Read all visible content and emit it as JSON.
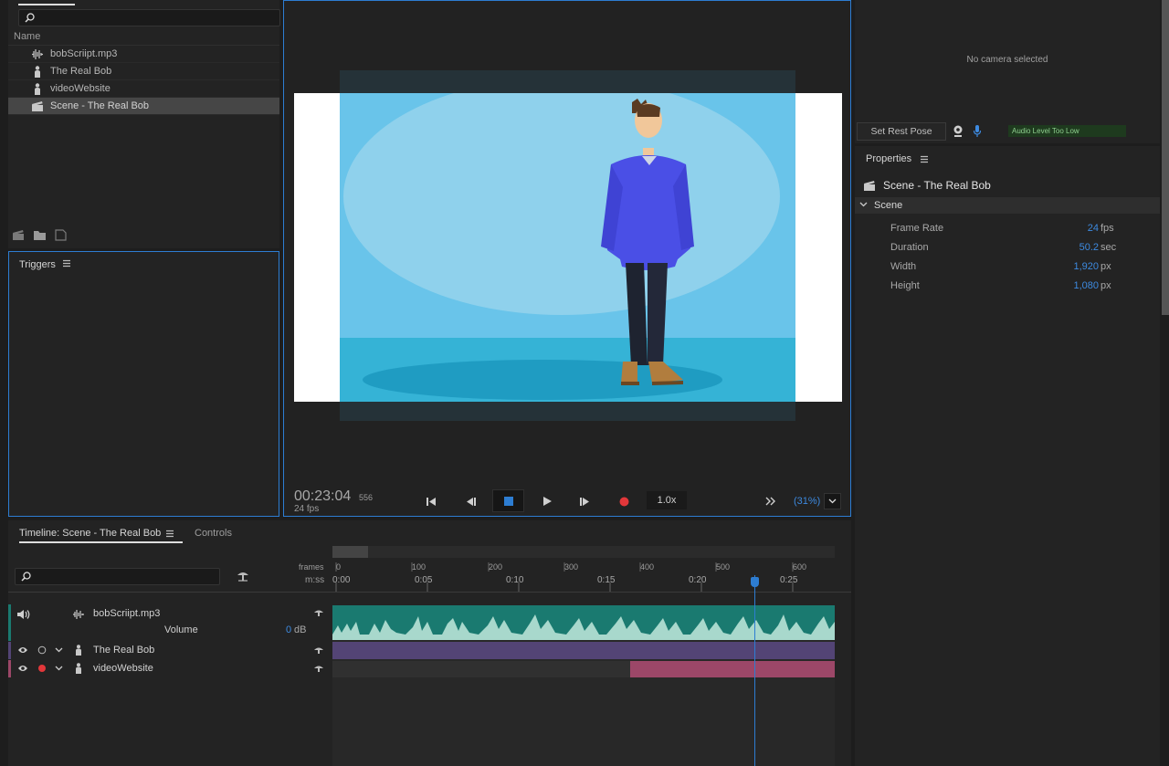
{
  "project": {
    "name_header": "Name",
    "items": [
      {
        "label": "bobScriipt.mp3",
        "icon": "audio-icon"
      },
      {
        "label": "The Real Bob",
        "icon": "puppet-icon"
      },
      {
        "label": "videoWebsite",
        "icon": "puppet-icon"
      },
      {
        "label": "Scene - The Real Bob",
        "icon": "scene-icon",
        "selected": true
      }
    ]
  },
  "triggers": {
    "title": "Triggers"
  },
  "stage": {
    "timecode": "00:23:04",
    "frame": "556",
    "fps": "24 fps",
    "speed": "1.0x",
    "zoom": "(31%)"
  },
  "camera": {
    "message": "No camera selected",
    "rest_pose_label": "Set Rest Pose",
    "audio_level": "Audio Level Too Low"
  },
  "properties": {
    "title": "Properties",
    "scene_name": "Scene - The Real Bob",
    "section": "Scene",
    "rows": [
      {
        "key": "Frame Rate",
        "value": "24",
        "unit": "fps"
      },
      {
        "key": "Duration",
        "value": "50.2",
        "unit": "sec"
      },
      {
        "key": "Width",
        "value": "1,920",
        "unit": "px"
      },
      {
        "key": "Height",
        "value": "1,080",
        "unit": "px"
      }
    ]
  },
  "timeline": {
    "tab_timeline": "Timeline: Scene - The Real Bob",
    "tab_controls": "Controls",
    "ruler_frames_label": "frames",
    "ruler_time_label": "m:ss",
    "frame_ticks": [
      "0",
      "100",
      "200",
      "300",
      "400",
      "500",
      "600"
    ],
    "time_ticks": [
      "0:00",
      "0:05",
      "0:10",
      "0:15",
      "0:20",
      "0:25"
    ],
    "tracks": {
      "audio": {
        "name": "bobScriipt.mp3",
        "param": "Volume",
        "param_value": "0",
        "param_unit": "dB"
      },
      "bob": {
        "name": "The Real Bob"
      },
      "video": {
        "name": "videoWebsite"
      }
    }
  },
  "colors": {
    "accent_blue": "#2d7dd2",
    "audio_clip": "#1a7a70",
    "bob_clip": "#534475",
    "video_clip": "#9c4768",
    "record_red": "#e2373a"
  }
}
